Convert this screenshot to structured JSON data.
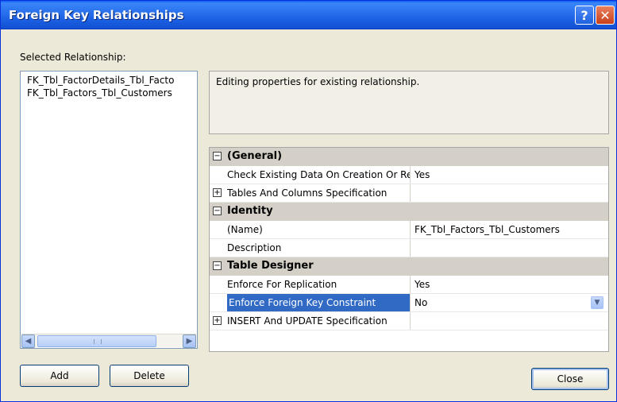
{
  "window": {
    "title": "Foreign Key Relationships",
    "help_glyph": "?",
    "close_glyph": "✕"
  },
  "selected_relationship_label": "Selected Relationship:",
  "relationships": [
    "FK_Tbl_FactorDetails_Tbl_Facto",
    "FK_Tbl_Factors_Tbl_Customers"
  ],
  "scrollbar": {
    "left_glyph": "◀",
    "right_glyph": "▶"
  },
  "description": "Editing properties for existing relationship.",
  "property_grid": {
    "categories": {
      "general": "(General)",
      "identity": "Identity",
      "table_designer": "Table Designer"
    },
    "rows": {
      "check_existing": {
        "name": "Check Existing Data On Creation Or Re-Enabling",
        "value": "Yes"
      },
      "tables_columns": {
        "name": "Tables And Columns Specification",
        "value": ""
      },
      "name": {
        "name": "(Name)",
        "value": "FK_Tbl_Factors_Tbl_Customers"
      },
      "description": {
        "name": "Description",
        "value": ""
      },
      "enforce_replication": {
        "name": "Enforce For Replication",
        "value": "Yes"
      },
      "enforce_fk": {
        "name": "Enforce Foreign Key Constraint",
        "value": "No"
      },
      "insert_update": {
        "name": "INSERT And UPDATE Specification",
        "value": ""
      }
    },
    "collapse_glyph": "−",
    "expand_glyph": "+",
    "dropdown_glyph": "▼"
  },
  "buttons": {
    "add": "Add",
    "delete": "Delete",
    "close": "Close"
  },
  "colors": {
    "title_bar": "#1b5fe2",
    "selection": "#316ac5",
    "dialog_bg": "#ece9d8"
  }
}
